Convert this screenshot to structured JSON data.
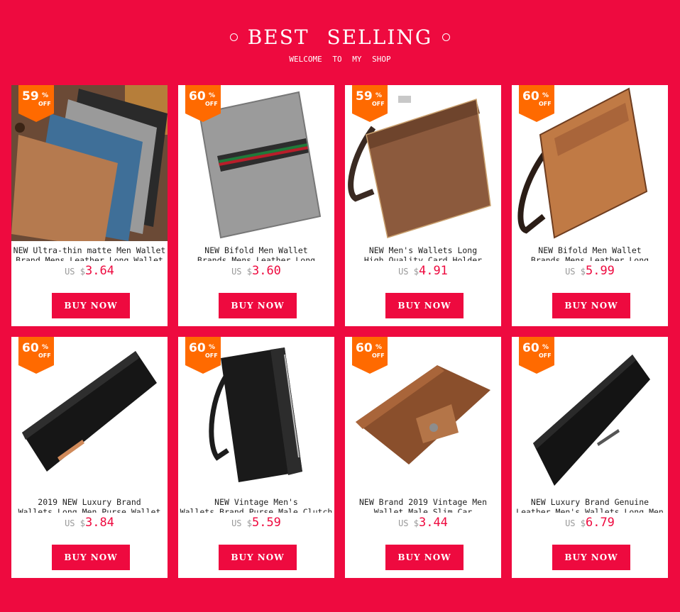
{
  "header": {
    "title": "BEST SELLING",
    "subtitle": "WELCOME TO MY SHOP"
  },
  "theme": {
    "brand": "#ee0a3f",
    "badge": "#ff6a00"
  },
  "products": [
    {
      "discount": "59",
      "pct_symbol": "%",
      "off": "OFF",
      "name_line1": "NEW Ultra-thin matte Men Wallet",
      "name_line2": "Brand Mens Leather Long Wallet",
      "currency": "US $",
      "price": "3.64",
      "buy": "BUY NOW"
    },
    {
      "discount": "60",
      "pct_symbol": "%",
      "off": "OFF",
      "name_line1": "NEW Bifold Men Wallet",
      "name_line2": "Brands Mens Leather Long",
      "currency": "US $",
      "price": "3.60",
      "buy": "BUY NOW"
    },
    {
      "discount": "59",
      "pct_symbol": "%",
      "off": "OFF",
      "name_line1": "NEW Men's Wallets Long",
      "name_line2": "High Quality Card Holder",
      "currency": "US $",
      "price": "4.91",
      "buy": "BUY NOW"
    },
    {
      "discount": "60",
      "pct_symbol": "%",
      "off": "OFF",
      "name_line1": "NEW Bifold Men Wallet",
      "name_line2": "Brands Mens Leather Long",
      "currency": "US $",
      "price": "5.99",
      "buy": "BUY NOW"
    },
    {
      "discount": "60",
      "pct_symbol": "%",
      "off": "OFF",
      "name_line1": "2019 NEW Luxury Brand",
      "name_line2": "Wallets Long Men Purse Wallet",
      "currency": "US $",
      "price": "3.84",
      "buy": "BUY NOW"
    },
    {
      "discount": "60",
      "pct_symbol": "%",
      "off": "OFF",
      "name_line1": "NEW Vintage Men's",
      "name_line2": "Wallets Brand Purse Male Clutch",
      "currency": "US $",
      "price": "5.59",
      "buy": "BUY NOW"
    },
    {
      "discount": "60",
      "pct_symbol": "%",
      "off": "OFF",
      "name_line1": "NEW Brand 2019 Vintage Men",
      "name_line2": "Wallet Male Slim Car",
      "currency": "US $",
      "price": "3.44",
      "buy": "BUY NOW"
    },
    {
      "discount": "60",
      "pct_symbol": "%",
      "off": "OFF",
      "name_line1": "NEW Luxury Brand Genuine",
      "name_line2": "Leather Men's Wallets Long Men",
      "currency": "US $",
      "price": "6.79",
      "buy": "BUY NOW"
    }
  ]
}
